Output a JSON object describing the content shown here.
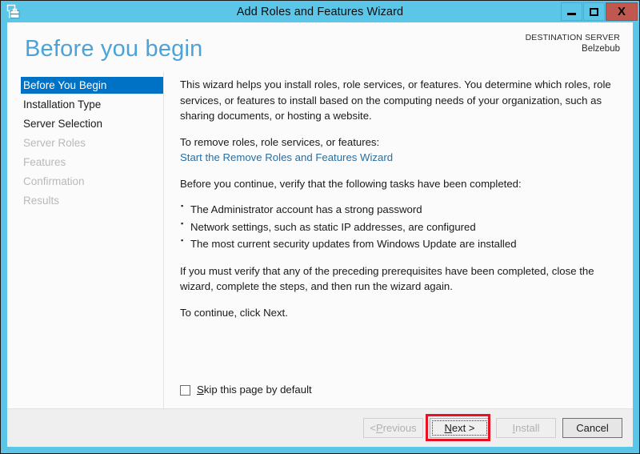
{
  "window": {
    "title": "Add Roles and Features Wizard",
    "icon": "wizard-toolbox-icon",
    "controls": {
      "minimize": "minimize-icon",
      "maximize": "maximize-icon",
      "close": "X"
    },
    "accent_titlebar": "#5bc6e8",
    "accent_close": "#c0584f"
  },
  "header": {
    "page_title": "Before you begin",
    "destination_label": "DESTINATION SERVER",
    "destination_name": "Belzebub",
    "title_color": "#4ba3d8"
  },
  "sidebar": {
    "items": [
      {
        "label": "Before You Begin",
        "state": "selected"
      },
      {
        "label": "Installation Type",
        "state": "enabled"
      },
      {
        "label": "Server Selection",
        "state": "enabled"
      },
      {
        "label": "Server Roles",
        "state": "disabled"
      },
      {
        "label": "Features",
        "state": "disabled"
      },
      {
        "label": "Confirmation",
        "state": "disabled"
      },
      {
        "label": "Results",
        "state": "disabled"
      }
    ],
    "selected_color": "#0072c6"
  },
  "content": {
    "intro": "This wizard helps you install roles, role services, or features. You determine which roles, role services, or features to install based on the computing needs of your organization, such as sharing documents, or hosting a website.",
    "remove_prompt": "To remove roles, role services, or features:",
    "remove_link": "Start the Remove Roles and Features Wizard",
    "link_color": "#2a6ea0",
    "verify_prompt": "Before you continue, verify that the following tasks have been completed:",
    "tasks": [
      "The Administrator account has a strong password",
      "Network settings, such as static IP addresses, are configured",
      "The most current security updates from Windows Update are installed"
    ],
    "prereq_note": "If you must verify that any of the preceding prerequisites have been completed, close the wizard, complete the steps, and then run the wizard again.",
    "continue_note": "To continue, click Next.",
    "skip_checkbox": {
      "label_accel": "S",
      "label_rest": "kip this page by default",
      "checked": false
    }
  },
  "footer": {
    "buttons": [
      {
        "name": "previous",
        "prefix": "< ",
        "accel": "P",
        "rest": "revious",
        "state": "disabled",
        "focused": false,
        "highlighted": false
      },
      {
        "name": "next",
        "prefix": "",
        "accel": "N",
        "rest": "ext >",
        "state": "enabled",
        "focused": true,
        "highlighted": true
      },
      {
        "name": "install",
        "prefix": "",
        "accel": "I",
        "rest": "nstall",
        "state": "disabled",
        "focused": false,
        "highlighted": false
      },
      {
        "name": "cancel",
        "prefix": "",
        "accel": "",
        "rest": "Cancel",
        "state": "enabled",
        "focused": false,
        "highlighted": false
      }
    ],
    "highlight_color": "#e81123"
  }
}
